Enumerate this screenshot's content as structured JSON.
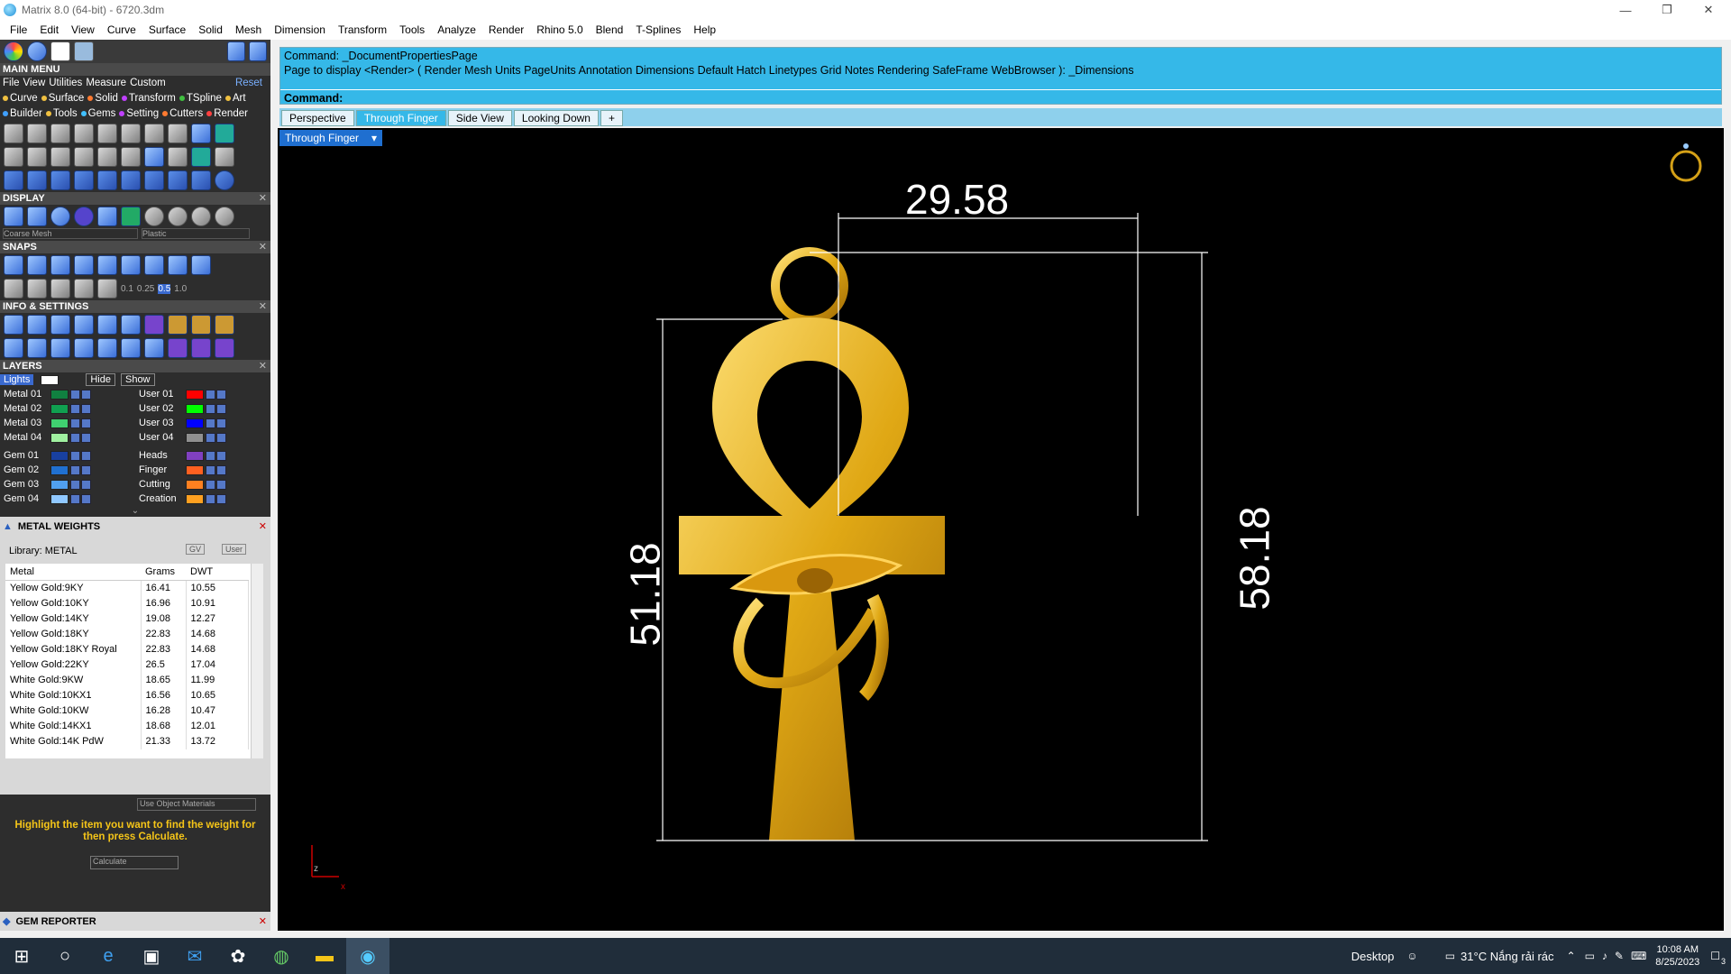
{
  "window": {
    "title": "Matrix 8.0 (64-bit) - 6720.3dm"
  },
  "menubar": [
    "File",
    "Edit",
    "View",
    "Curve",
    "Surface",
    "Solid",
    "Mesh",
    "Dimension",
    "Transform",
    "Tools",
    "Analyze",
    "Render",
    "Rhino 5.0",
    "Blend",
    "T-Splines",
    "Help"
  ],
  "left": {
    "main_menu": "MAIN MENU",
    "main_items": [
      "File",
      "View",
      "Utilities",
      "Measure",
      "Custom"
    ],
    "reset": "Reset",
    "sub1": [
      {
        "label": "Curve",
        "color": "#f0c040"
      },
      {
        "label": "Surface",
        "color": "#f0c040"
      },
      {
        "label": "Solid",
        "color": "#ff7a30"
      },
      {
        "label": "Transform",
        "color": "#c040ff"
      },
      {
        "label": "TSpline",
        "color": "#40c040"
      },
      {
        "label": "Art",
        "color": "#f0c040"
      }
    ],
    "sub2": [
      {
        "label": "Builder",
        "color": "#40a0ff"
      },
      {
        "label": "Tools",
        "color": "#f0c040"
      },
      {
        "label": "Gems",
        "color": "#40c0ff"
      },
      {
        "label": "Setting",
        "color": "#c040ff"
      },
      {
        "label": "Cutters",
        "color": "#ff7a30"
      },
      {
        "label": "Render",
        "color": "#ff4040"
      }
    ],
    "display": "DISPLAY",
    "display_mesh": "Coarse Mesh",
    "display_mat": "Plastic",
    "snaps": "SNAPS",
    "snap_values": [
      "0.1",
      "0.25",
      "0.5",
      "1.0"
    ],
    "info": "INFO & SETTINGS",
    "layers": "LAYERS",
    "lights": "Lights",
    "hide": "Hide",
    "show": "Show",
    "layer_left": [
      {
        "name": "Metal 01",
        "color": "#108040"
      },
      {
        "name": "Metal 02",
        "color": "#10a050"
      },
      {
        "name": "Metal 03",
        "color": "#40d070"
      },
      {
        "name": "Metal 04",
        "color": "#a0f0a0"
      },
      {
        "name": "Gem 01",
        "color": "#1840a0"
      },
      {
        "name": "Gem 02",
        "color": "#2070d0"
      },
      {
        "name": "Gem 03",
        "color": "#50a0f0"
      },
      {
        "name": "Gem 04",
        "color": "#90c8ff"
      }
    ],
    "layer_right": [
      {
        "name": "User 01",
        "color": "#ff0000"
      },
      {
        "name": "User 02",
        "color": "#00ff00"
      },
      {
        "name": "User 03",
        "color": "#0000ff"
      },
      {
        "name": "User 04",
        "color": "#909090"
      },
      {
        "name": "Heads",
        "color": "#8040c0"
      },
      {
        "name": "Finger",
        "color": "#ff6020"
      },
      {
        "name": "Cutting",
        "color": "#ff8020"
      },
      {
        "name": "Creation",
        "color": "#ffa020"
      }
    ],
    "metal_weights": "METAL WEIGHTS",
    "library": "Library: METAL",
    "gv": "GV",
    "user": "User",
    "mw_headers": [
      "Metal",
      "Grams",
      "DWT"
    ],
    "mw_rows": [
      [
        "Yellow Gold:9KY",
        "16.41",
        "10.55"
      ],
      [
        "Yellow Gold:10KY",
        "16.96",
        "10.91"
      ],
      [
        "Yellow Gold:14KY",
        "19.08",
        "12.27"
      ],
      [
        "Yellow Gold:18KY",
        "22.83",
        "14.68"
      ],
      [
        "Yellow Gold:18KY Royal",
        "22.83",
        "14.68"
      ],
      [
        "Yellow Gold:22KY",
        "26.5",
        "17.04"
      ],
      [
        "White Gold:9KW",
        "18.65",
        "11.99"
      ],
      [
        "White Gold:10KX1",
        "16.56",
        "10.65"
      ],
      [
        "White Gold:10KW",
        "16.28",
        "10.47"
      ],
      [
        "White Gold:14KX1",
        "18.68",
        "12.01"
      ],
      [
        "White Gold:14K PdW",
        "21.33",
        "13.72"
      ]
    ],
    "use_object": "Use Object Materials",
    "hint": "Highlight the item you want to find the weight for then press Calculate.",
    "calculate": "Calculate",
    "gem_reporter": "GEM REPORTER"
  },
  "command": {
    "line1": "Command: _DocumentPropertiesPage",
    "line2": "Page to display <Render> ( Render  Mesh  Units  PageUnits  Annotation  Dimensions  Default  Hatch  Linetypes  Grid  Notes  Rendering  SafeFrame  WebBrowser ): _Dimensions",
    "prompt": "Command:"
  },
  "tabs": [
    "Perspective",
    "Through Finger",
    "Side View",
    "Looking Down",
    "+"
  ],
  "active_tab": "Through Finger",
  "viewport": {
    "label": "Through Finger",
    "dim_width": "29.58",
    "dim_height_left": "51.18",
    "dim_height_right": "58.18",
    "axis_z": "z",
    "axis_x": "x"
  },
  "taskbar": {
    "desktop": "Desktop",
    "weather": "31°C  Nắng rải rác",
    "time": "10:08 AM",
    "date": "8/25/2023",
    "notif": "3"
  }
}
